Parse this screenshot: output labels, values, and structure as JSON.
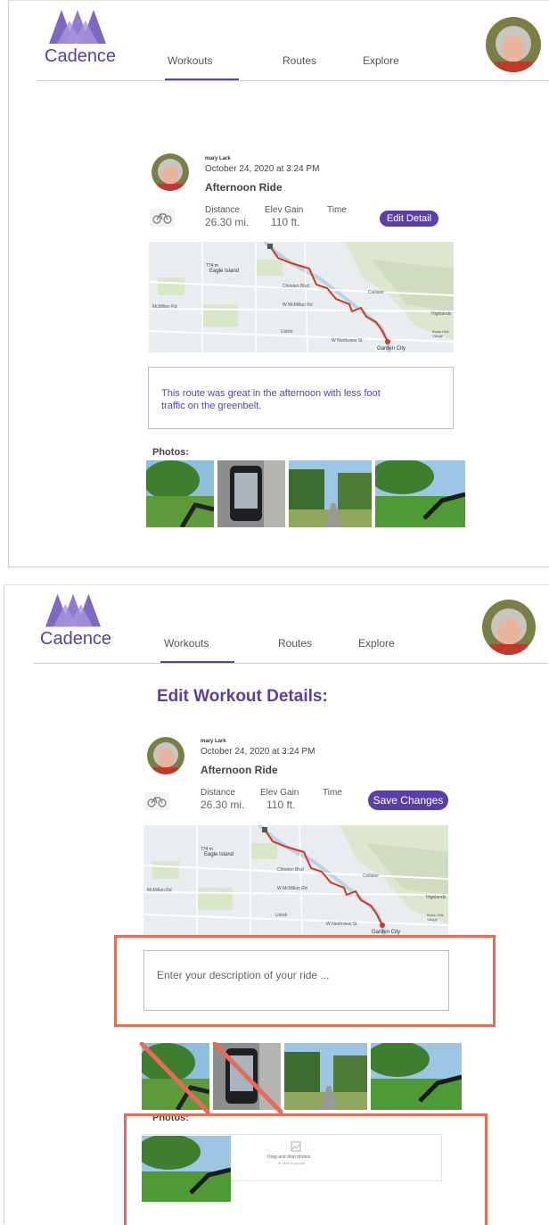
{
  "app": {
    "brand": "Cadence",
    "accent_color": "#5b3fa6",
    "annotation_color": "#e86a5a"
  },
  "nav": {
    "tabs": [
      {
        "label": "Workouts",
        "active": true
      },
      {
        "label": "Routes",
        "active": false
      },
      {
        "label": "Explore",
        "active": false
      }
    ]
  },
  "workout": {
    "user": "mary Lark",
    "date": "October 24, 2020 at 3:24 PM",
    "title": "Afternoon Ride",
    "activity_icon": "bicycle-icon",
    "stats": {
      "distance_label": "Distance",
      "distance_value": "26.30 mi.",
      "elev_label": "Elev Gain",
      "elev_value": "110 ft.",
      "time_label": "Time"
    },
    "map_labels": {
      "eagle_island": "Eagle Island",
      "garden_city": "Garden City",
      "chinden": "Chinden Blvd",
      "mcmillan": "W McMillan Rd",
      "mcmillan_left": "McMillan Rd",
      "northview": "W Northview St",
      "ustick": "Ustick",
      "highlands": "Highlands",
      "collister": "Collister",
      "boise_hills": "Boise Hills Village",
      "meridian": "N Meridian Rd",
      "elev_tag": "774 m"
    }
  },
  "view_panel": {
    "edit_button": "Edit Detail",
    "description": "This route was great in the afternoon with less foot traffic on the greenbelt.",
    "photos_label": "Photos:"
  },
  "edit_panel": {
    "heading": "Edit Workout Details:",
    "save_button": "Save Changes",
    "description_placeholder": "Enter your description of your ride ...",
    "photos_label": "Photos:",
    "upload_title": "Drag and drop photos",
    "upload_subtitle": "or click to upload"
  }
}
